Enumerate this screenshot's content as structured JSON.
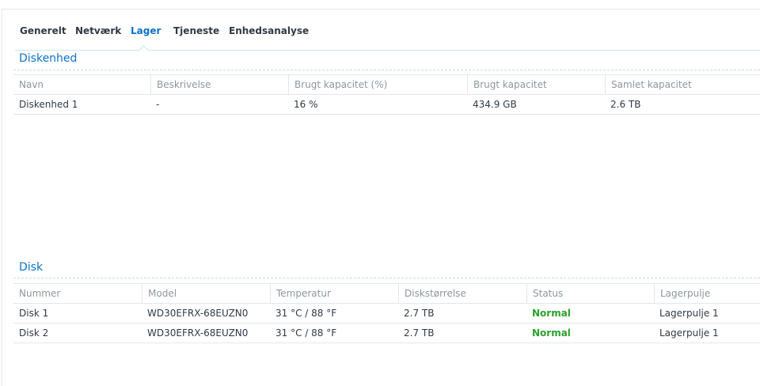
{
  "tabs": [
    {
      "label": "Generelt",
      "active": false
    },
    {
      "label": "Netværk",
      "active": false
    },
    {
      "label": "Lager",
      "active": true
    },
    {
      "label": "Tjeneste",
      "active": false
    },
    {
      "label": "Enhedsanalyse",
      "active": false
    }
  ],
  "volumes": {
    "title": "Diskenhed",
    "columns": [
      "Navn",
      "Beskrivelse",
      "Brugt kapacitet (%)",
      "Brugt kapacitet",
      "Samlet kapacitet"
    ],
    "rows": [
      [
        "Diskenhed 1",
        "-",
        "16 %",
        "434.9 GB",
        "2.6 TB"
      ]
    ]
  },
  "disks": {
    "title": "Disk",
    "columns": [
      "Nummer",
      "Model",
      "Temperatur",
      "Diskstørrelse",
      "Status",
      "Lagerpulje"
    ],
    "rows": [
      [
        "Disk 1",
        "WD30EFRX-68EUZN0",
        "31 °C / 88 °F",
        "2.7 TB",
        "Normal",
        "Lagerpulje 1"
      ],
      [
        "Disk 2",
        "WD30EFRX-68EUZN0",
        "31 °C / 88 °F",
        "2.7 TB",
        "Normal",
        "Lagerpulje 1"
      ]
    ]
  },
  "colors": {
    "accent": "#0d73c9",
    "status_normal": "#2aa12a",
    "header_text": "#8d97a1"
  }
}
